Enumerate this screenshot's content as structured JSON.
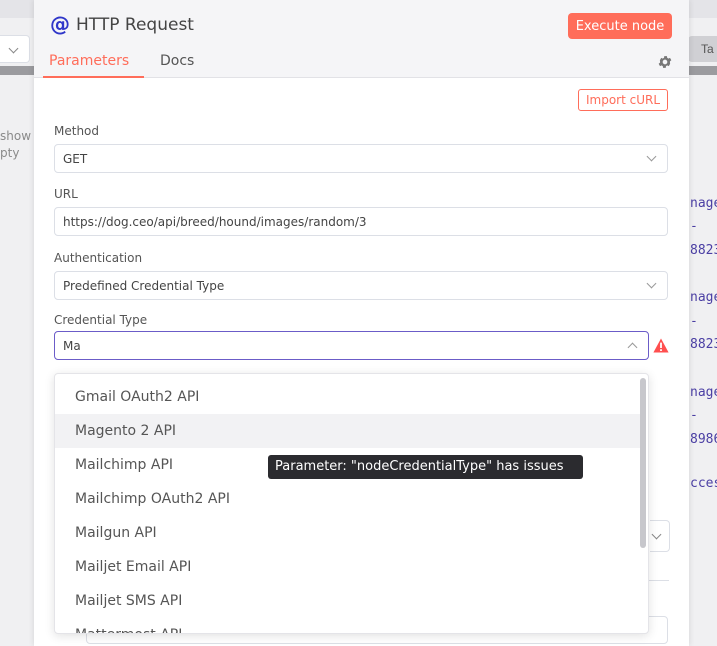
{
  "background": {
    "left_text": [
      "show",
      "pty"
    ],
    "tab_label": "Ta",
    "right_text": [
      "nage",
      "-",
      "8823",
      "nage",
      "-",
      "8823",
      "nage",
      "-",
      "8986",
      "cces"
    ]
  },
  "node": {
    "icon": "@",
    "title": "HTTP Request",
    "execute_label": "Execute node",
    "tabs": [
      {
        "label": "Parameters",
        "active": true
      },
      {
        "label": "Docs",
        "active": false
      }
    ],
    "settings_icon": "gear-icon"
  },
  "import_curl_label": "Import cURL",
  "fields": {
    "method": {
      "label": "Method",
      "value": "GET"
    },
    "url": {
      "label": "URL",
      "value": "https://dog.ceo/api/breed/hound/images/random/3"
    },
    "authentication": {
      "label": "Authentication",
      "value": "Predefined Credential Type"
    },
    "credential_type": {
      "label": "Credential Type",
      "value": "Ma"
    }
  },
  "dropdown": {
    "items": [
      "Gmail OAuth2 API",
      "Magento 2 API",
      "Mailchimp API",
      "Mailchimp OAuth2 API",
      "Mailgun API",
      "Mailjet Email API",
      "Mailjet SMS API",
      "Mattermost API"
    ],
    "hovered_index": 1
  },
  "tooltip": "Parameter: \"nodeCredentialType\" has issues",
  "colors": {
    "accent": "#ff6d5a",
    "focus": "#6b5cc8",
    "warning": "#ff4f4f",
    "node_icon": "#2f36c9"
  }
}
